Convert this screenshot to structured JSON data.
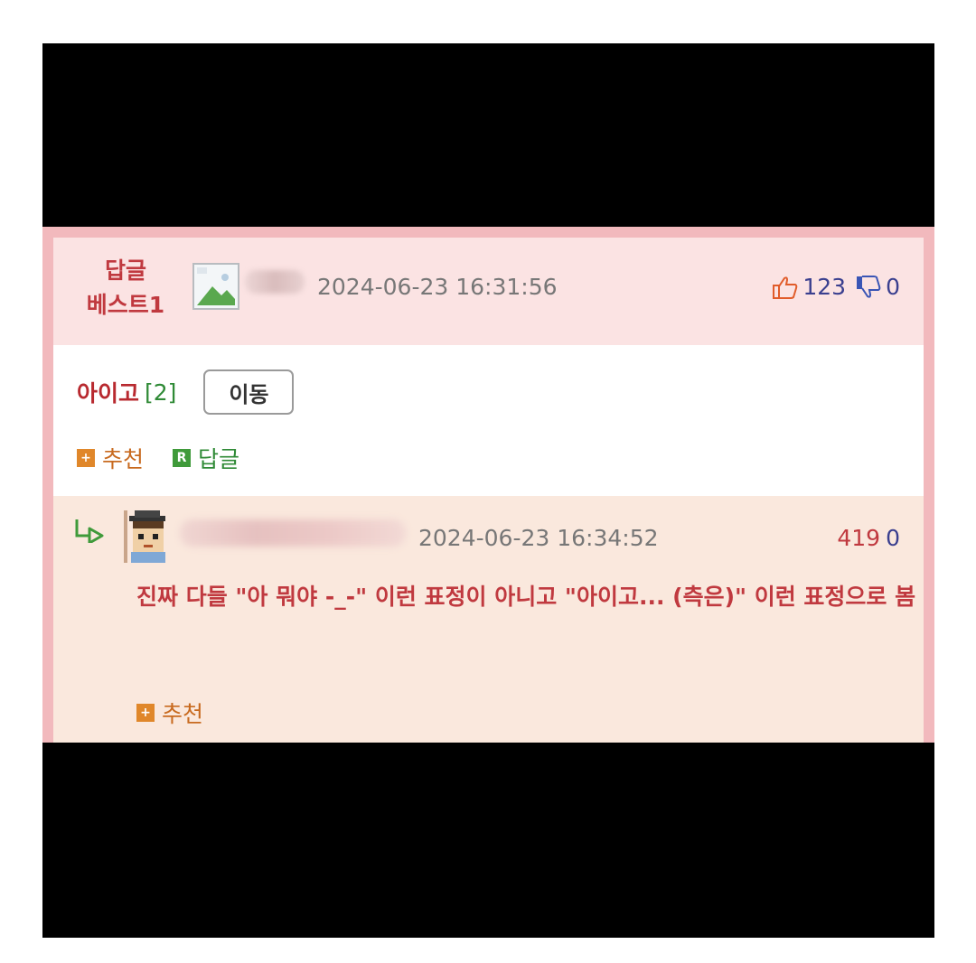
{
  "comment": {
    "badge_line1": "답글",
    "badge_line2": "베스트1",
    "timestamp": "2024-06-23 16:31:56",
    "upvotes": "123",
    "downvotes": "0",
    "title": "아이고",
    "reply_count": "[2]",
    "move_button_label": "이동",
    "recommend_label": "추천",
    "reply_label": "답글",
    "recommend_icon_glyph": "+",
    "reply_icon_glyph": "R"
  },
  "reply": {
    "timestamp": "2024-06-23 16:34:52",
    "upvotes": "419",
    "downvotes": "0",
    "text": "진짜 다들 \"아 뭐야 -_-\" 이런 표정이 아니고 \"아이고... (측은)\" 이런 표정으로 봄",
    "recommend_label": "추천",
    "recommend_icon_glyph": "+"
  },
  "colors": {
    "accent_red": "#c0393f",
    "green": "#3f9a3a",
    "orange": "#e0872a",
    "header_bg": "#fbe3e3",
    "reply_bg": "#fae8dd",
    "border_pink": "#f2b9bd"
  },
  "icons": {
    "thumbs_up": "thumbs-up-icon",
    "thumbs_down": "thumbs-down-icon",
    "reply_arrow": "reply-arrow-icon",
    "broken_image": "broken-image-icon",
    "user_avatar": "user-avatar-icon"
  }
}
